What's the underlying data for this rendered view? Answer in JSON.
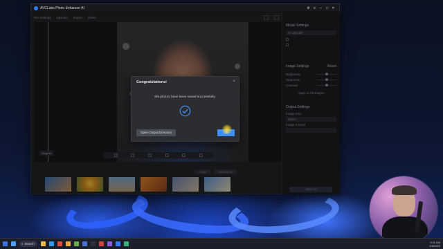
{
  "window": {
    "title": "AVCLabs Photo Enhancer AI",
    "controls": [
      "⚙",
      "≡",
      "–",
      "□",
      "✕"
    ]
  },
  "toolbar": {
    "items": [
      "Pre Settings",
      "Upscale",
      "Export",
      "Share"
    ]
  },
  "viewer": {
    "tag": "Original"
  },
  "film": {
    "add_label": "+ Add",
    "remove_label": "Remove All"
  },
  "settings": {
    "section_model": "Model Settings",
    "model_value": "AI Upscale",
    "image_settings": "Image Settings",
    "image_reset": "Reset",
    "brightness": "Brightness",
    "saturation": "Saturation",
    "contrast": "Contrast",
    "apply_all": "Apply to All Images",
    "output_settings": "Output Settings",
    "image_size": "Image Size",
    "size_value": "200%",
    "image_format": "Image Format",
    "start_label": "Start All"
  },
  "dialog": {
    "title": "Congratulations!",
    "close_glyph": "×",
    "message": "6/6 photos have been saved successfully.",
    "open_dir_label": "Open Output Directory",
    "ok_label": "OK"
  },
  "taskbar": {
    "search_label": "Search",
    "tray_time": "9:22 AM",
    "tray_date": "4/5/2023"
  },
  "colors": {
    "accent": "#3f8ef5",
    "dialog_bg": "#2b2d31",
    "taskbar_bg": "#1b1f2b"
  }
}
